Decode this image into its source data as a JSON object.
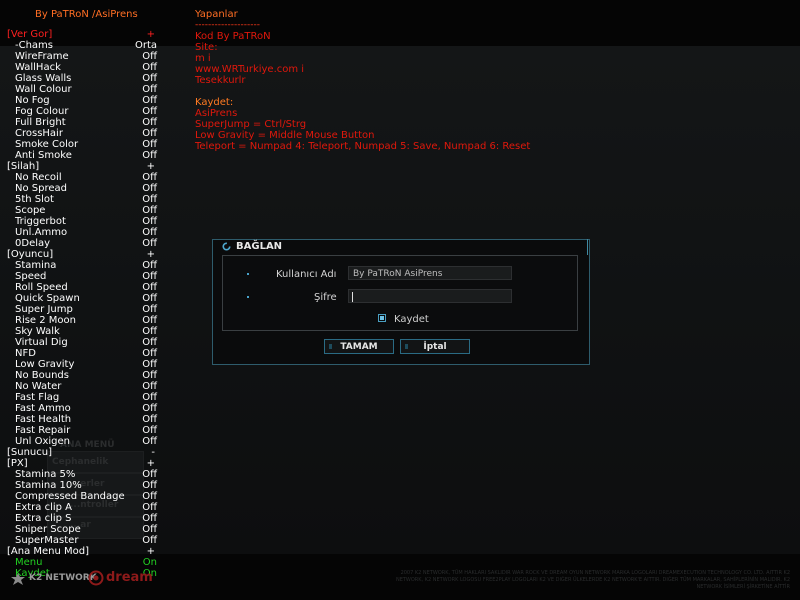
{
  "header": {
    "credits_title": "By PaTRoN /AsiPrens",
    "yapanlar": "Yapanlar",
    "dashes": "--------------------"
  },
  "info_lines": [
    {
      "text": "Kod By PaTRoN",
      "color": "red"
    },
    {
      "text": "Site:",
      "color": "red"
    },
    {
      "text": "m      i",
      "color": "red"
    },
    {
      "text": "www.WRTurkiye.com      i",
      "color": "red"
    },
    {
      "text": "Tesekkurlr",
      "color": "red"
    },
    {
      "text": "",
      "color": "red"
    },
    {
      "text": "Kaydet:",
      "color": "orange"
    },
    {
      "text": "AsiPrens",
      "color": "red"
    },
    {
      "text": "SuperJump = Ctrl/Strg",
      "color": "red"
    },
    {
      "text": "Low Gravity = Middle Mouse Button",
      "color": "red"
    },
    {
      "text": "Teleport = Numpad 4: Teleport, Numpad 5: Save, Numpad 6: Reset",
      "color": "red"
    }
  ],
  "menu_rows": [
    {
      "type": "section",
      "label": "[Ver Gor]",
      "value": "+",
      "color": "red"
    },
    {
      "type": "item",
      "label": "-Chams",
      "value": "Orta"
    },
    {
      "type": "item",
      "label": "WireFrame",
      "value": "Off"
    },
    {
      "type": "item",
      "label": "WallHack",
      "value": "Off"
    },
    {
      "type": "item",
      "label": "Glass Walls",
      "value": "Off"
    },
    {
      "type": "item",
      "label": "Wall Colour",
      "value": "Off"
    },
    {
      "type": "item",
      "label": "No Fog",
      "value": "Off"
    },
    {
      "type": "item",
      "label": "Fog Colour",
      "value": "Off"
    },
    {
      "type": "item",
      "label": "Full Bright",
      "value": "Off"
    },
    {
      "type": "item",
      "label": "CrossHair",
      "value": "Off"
    },
    {
      "type": "item",
      "label": "Smoke Color",
      "value": "Off"
    },
    {
      "type": "item",
      "label": "Anti Smoke",
      "value": "Off"
    },
    {
      "type": "section",
      "label": "[Silah]",
      "value": "+"
    },
    {
      "type": "item",
      "label": "No Recoil",
      "value": "Off"
    },
    {
      "type": "item",
      "label": "No Spread",
      "value": "Off"
    },
    {
      "type": "item",
      "label": "5th Slot",
      "value": "Off"
    },
    {
      "type": "item",
      "label": "Scope",
      "value": "Off"
    },
    {
      "type": "item",
      "label": "Triggerbot",
      "value": "Off"
    },
    {
      "type": "item",
      "label": "Unl.Ammo",
      "value": "Off"
    },
    {
      "type": "item",
      "label": "0Delay",
      "value": "Off"
    },
    {
      "type": "section",
      "label": "[Oyuncu]",
      "value": "+"
    },
    {
      "type": "item",
      "label": "Stamina",
      "value": "Off"
    },
    {
      "type": "item",
      "label": "Speed",
      "value": "Off"
    },
    {
      "type": "item",
      "label": "Roll Speed",
      "value": "Off"
    },
    {
      "type": "item",
      "label": "Quick Spawn",
      "value": "Off"
    },
    {
      "type": "item",
      "label": "Super Jump",
      "value": "Off"
    },
    {
      "type": "item",
      "label": "Rise 2 Moon",
      "value": "Off"
    },
    {
      "type": "item",
      "label": "Sky Walk",
      "value": "Off"
    },
    {
      "type": "item",
      "label": "Virtual Dig",
      "value": "Off"
    },
    {
      "type": "item",
      "label": "NFD",
      "value": "Off"
    },
    {
      "type": "item",
      "label": "Low Gravity",
      "value": "Off"
    },
    {
      "type": "item",
      "label": "No Bounds",
      "value": "Off"
    },
    {
      "type": "item",
      "label": "No Water",
      "value": "Off"
    },
    {
      "type": "item",
      "label": "Fast Flag",
      "value": "Off"
    },
    {
      "type": "item",
      "label": "Fast Ammo",
      "value": "Off"
    },
    {
      "type": "item",
      "label": "Fast Health",
      "value": "Off"
    },
    {
      "type": "item",
      "label": "Fast Repair",
      "value": "Off"
    },
    {
      "type": "item",
      "label": "Unl Oxigen",
      "value": "Off"
    },
    {
      "type": "section",
      "label": "[Sunucu]",
      "value": "-"
    },
    {
      "type": "section",
      "label": "[PX]",
      "value": "+"
    },
    {
      "type": "item",
      "label": "Stamina 5%",
      "value": "Off"
    },
    {
      "type": "item",
      "label": "Stamina 10%",
      "value": "Off"
    },
    {
      "type": "item",
      "label": "Compressed Bandage",
      "value": "Off"
    },
    {
      "type": "item",
      "label": "Extra clip A",
      "value": "Off"
    },
    {
      "type": "item",
      "label": "Extra clip S",
      "value": "Off"
    },
    {
      "type": "item",
      "label": "Sniper Scope",
      "value": "Off"
    },
    {
      "type": "item",
      "label": "SuperMaster",
      "value": "Off"
    },
    {
      "type": "section",
      "label": "[Ana Menu Mod]",
      "value": "+"
    },
    {
      "type": "item",
      "label": "Menu",
      "value": "On",
      "color": "green"
    },
    {
      "type": "item",
      "label": "Kaydet",
      "value": "On",
      "color": "green"
    }
  ],
  "ghost_menu": {
    "title": "ANA MENÜ",
    "items": [
      "Cephanelik",
      "...erler",
      "...ntroller",
      "...ar"
    ]
  },
  "dialog": {
    "title": "BAĞLAN",
    "username_label": "Kullanıcı Adı",
    "username_value": "By PaTRoN  AsiPrens",
    "password_label": "Şifre",
    "password_value": "",
    "remember_label": "Kaydet",
    "ok_label": "TAMAM",
    "cancel_label": "İptal"
  },
  "footer": {
    "k2": "K2 NETWORK",
    "dream": "dream",
    "legal": "2007 K2 NETWORK, TÜM HAKLARI SAKLIDIR WAR ROCK VE DREAM OYUN NETWORK MARKA LOGOLARI DREAMEXECUTION TECHNOLOGY CO. LTD. AITTIR K2 NETWORK, K2 NETWORK LOGOSU FREE2PLAY LOGOLARI K2 VE DIĞER ÜLKELERDE K2 NETWORK'E AITTIR. DIĞER TÜM MARKALAR, SAHİPLERİNİN MALIDIR. K2 NETWORK İSİMLERİ ŞİRKETİNE AİTTİR"
  },
  "colors": {
    "accent": "#3f8aa2",
    "menu_red": "#ff2020",
    "menu_green": "#22d022",
    "orange": "#ff6e24"
  }
}
